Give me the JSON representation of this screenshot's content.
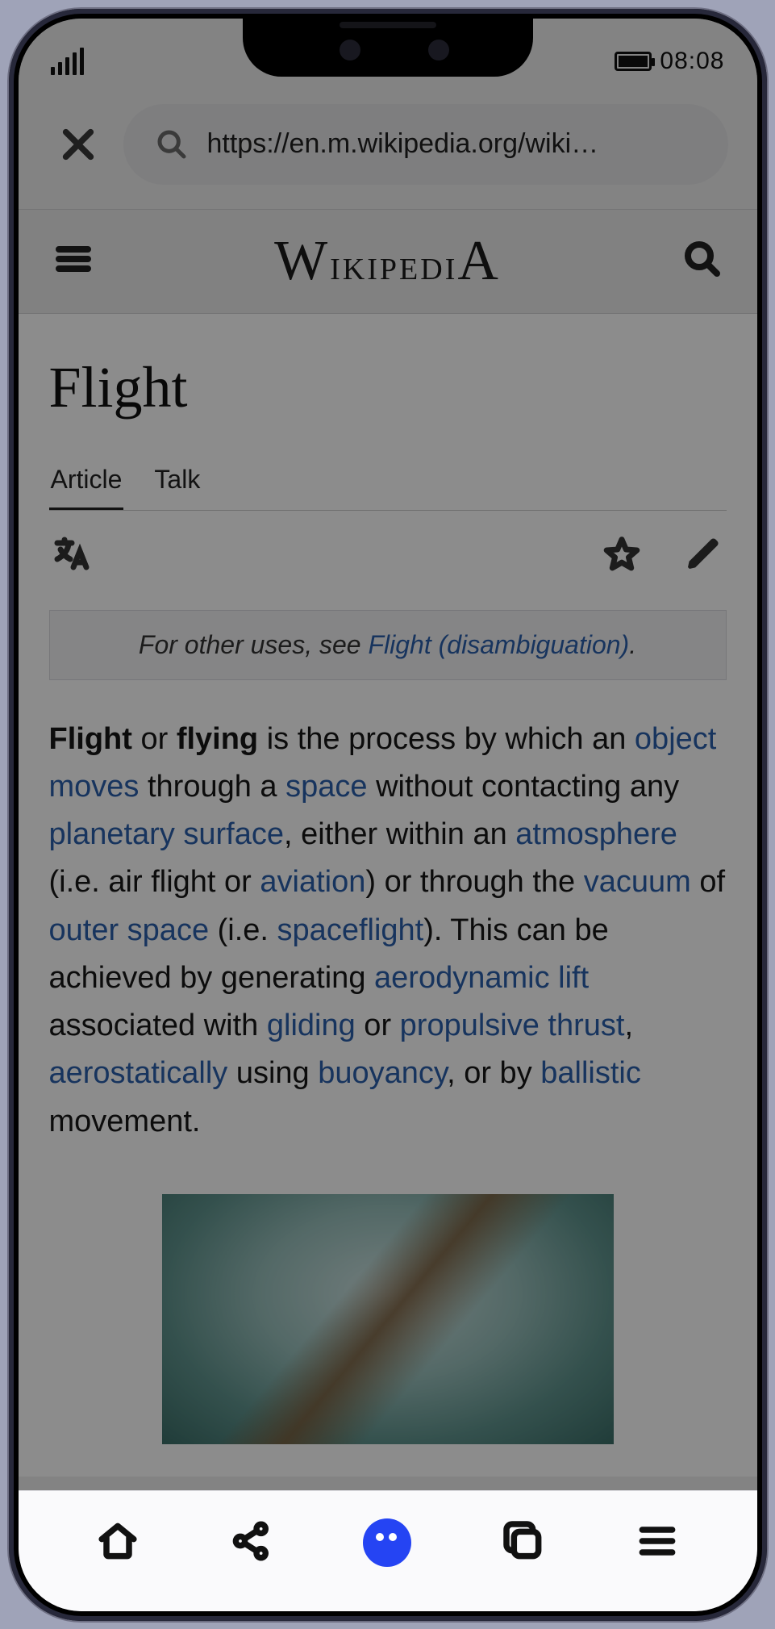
{
  "status": {
    "time": "08:08"
  },
  "browser": {
    "url_display": "https://en.m.wikipedia.org/wiki…"
  },
  "wiki": {
    "logo_text": "Wikipedia",
    "search_icon": "search-icon",
    "menu_icon": "hamburger-icon"
  },
  "article": {
    "title": "Flight",
    "tabs": {
      "article": "Article",
      "talk": "Talk"
    },
    "hatnote_prefix": "For other uses, see ",
    "hatnote_link": "Flight (disambiguation)",
    "hatnote_suffix": ".",
    "lead": {
      "b1": "Flight",
      "t1": " or ",
      "b2": "flying",
      "t2": " is the process by which an ",
      "l_object": "object",
      "sp1": " ",
      "l_moves": "moves",
      "t3": " through a ",
      "l_space": "space",
      "t4": " without contacting any ",
      "l_plansurf": "planetary surface",
      "t5": ", either within an ",
      "l_atmos": "atmosphere",
      "t6": " (i.e. air flight or ",
      "l_aviation": "aviation",
      "t7": ") or through the ",
      "l_vacuum": "vacuum",
      "t8": " of ",
      "l_outerspace": "outer space",
      "t9": " (i.e. ",
      "l_spaceflight": "spaceflight",
      "t10": "). This can be achieved by generating ",
      "l_aerolift": "aerodynamic lift",
      "t11": " associated with ",
      "l_gliding": "gliding",
      "t12": " or ",
      "l_propthrust": "propulsive thrust",
      "t13": ", ",
      "l_aerostat": "aerostatically",
      "t14": " using ",
      "l_buoyancy": "buoyancy",
      "t15": ", or by ",
      "l_ballistic": "ballistic",
      "t16": " movement."
    }
  },
  "icons": {
    "close": "close-icon",
    "url_search": "search-icon",
    "language": "language-icon",
    "star": "star-icon",
    "edit": "edit-pencil-icon",
    "nav_home": "home-icon",
    "nav_share": "share-icon",
    "nav_center": "assistant-icon",
    "nav_tabs": "tabs-icon",
    "nav_menu": "menu-icon",
    "signal": "signal-icon",
    "battery": "battery-icon"
  }
}
